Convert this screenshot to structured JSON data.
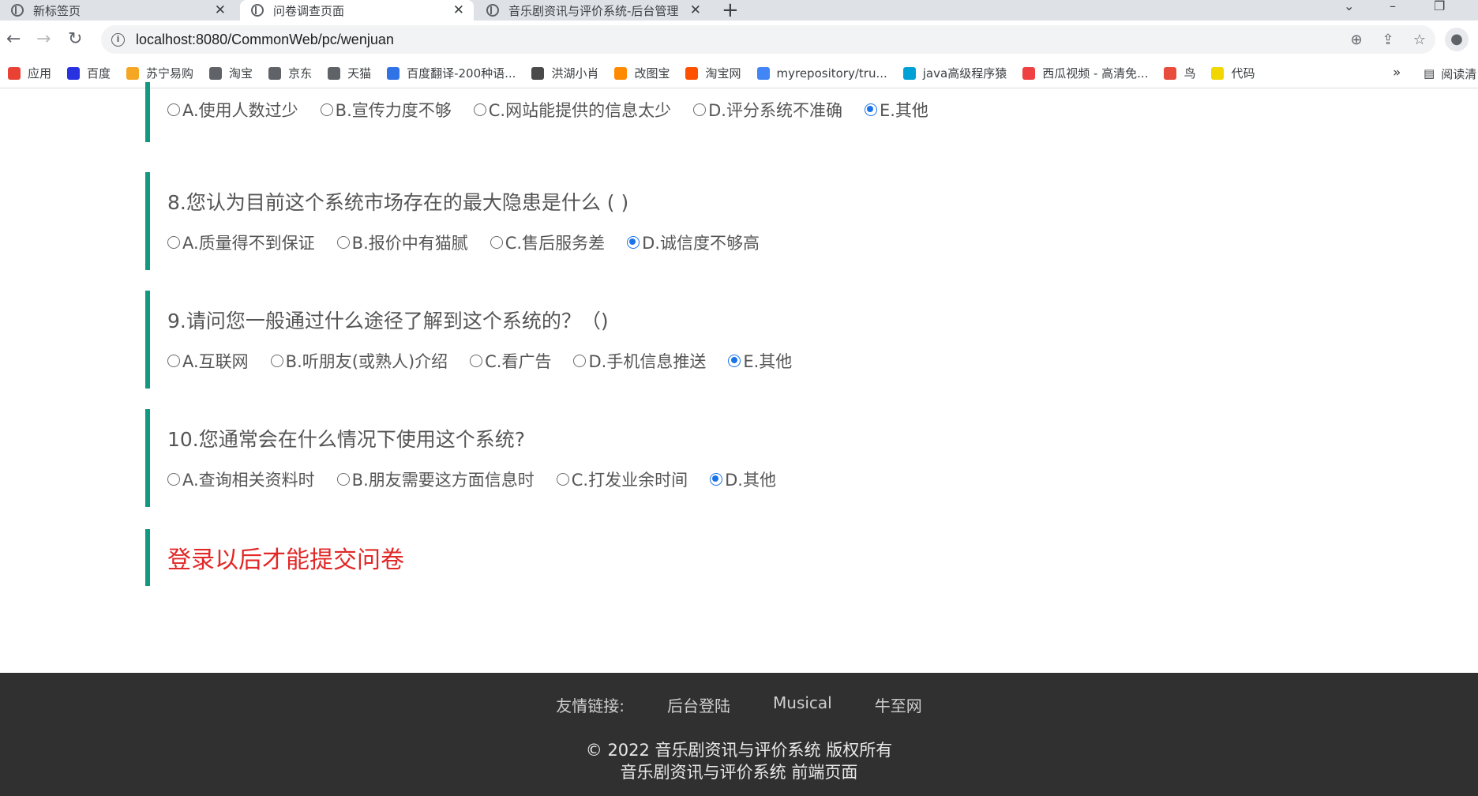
{
  "browser": {
    "tabs": [
      {
        "title": "新标签页",
        "close": "✕"
      },
      {
        "title": "问卷调查页面",
        "close": "✕"
      },
      {
        "title": "音乐剧资讯与评价系统-后台管理",
        "close": "✕"
      }
    ],
    "new_tab": "+",
    "url": "localhost:8080/CommonWeb/pc/wenjuan",
    "bookmarks": [
      {
        "label": "应用",
        "color": "#e94235"
      },
      {
        "label": "百度",
        "color": "#2932e1"
      },
      {
        "label": "苏宁易购",
        "color": "#f5a623"
      },
      {
        "label": "淘宝",
        "color": "#5f6368"
      },
      {
        "label": "京东",
        "color": "#5f6368"
      },
      {
        "label": "天猫",
        "color": "#5f6368"
      },
      {
        "label": "百度翻译-200种语...",
        "color": "#2f73e6"
      },
      {
        "label": "洪湖小肖",
        "color": "#4a4a4a"
      },
      {
        "label": "改图宝",
        "color": "#ff8a00"
      },
      {
        "label": "淘宝网",
        "color": "#ff5000"
      },
      {
        "label": "myrepository/tru...",
        "color": "#4285f4"
      },
      {
        "label": "java高级程序猿",
        "color": "#00a1d6"
      },
      {
        "label": "西瓜视频 - 高清免...",
        "color": "#f04142"
      },
      {
        "label": "鸟",
        "color": "#e74c3c"
      },
      {
        "label": "代码",
        "color": "#f2d600"
      }
    ],
    "bookmarks_more": "»",
    "reading_list": "阅读清"
  },
  "questions": [
    {
      "title": "",
      "options": [
        {
          "label": "A.使用人数过少",
          "checked": false
        },
        {
          "label": "B.宣传力度不够",
          "checked": false
        },
        {
          "label": "C.网站能提供的信息太少",
          "checked": false
        },
        {
          "label": "D.评分系统不准确",
          "checked": false
        },
        {
          "label": "E.其他",
          "checked": true
        }
      ]
    },
    {
      "title": "8.您认为目前这个系统市场存在的最大隐患是什么 ( )",
      "options": [
        {
          "label": "A.质量得不到保证",
          "checked": false
        },
        {
          "label": "B.报价中有猫腻",
          "checked": false
        },
        {
          "label": "C.售后服务差",
          "checked": false
        },
        {
          "label": "D.诚信度不够高",
          "checked": true
        }
      ]
    },
    {
      "title": "9.请问您一般通过什么途径了解到这个系统的？（)",
      "options": [
        {
          "label": "A.互联网",
          "checked": false
        },
        {
          "label": "B.听朋友(或熟人)介绍",
          "checked": false
        },
        {
          "label": "C.看广告",
          "checked": false
        },
        {
          "label": "D.手机信息推送",
          "checked": false
        },
        {
          "label": "E.其他",
          "checked": true
        }
      ]
    },
    {
      "title": "10.您通常会在什么情况下使用这个系统?",
      "options": [
        {
          "label": "A.查询相关资料时",
          "checked": false
        },
        {
          "label": "B.朋友需要这方面信息时",
          "checked": false
        },
        {
          "label": "C.打发业余时间",
          "checked": false
        },
        {
          "label": "D.其他",
          "checked": true
        }
      ]
    }
  ],
  "login_notice": "登录以后才能提交问卷",
  "footer": {
    "links_label": "友情链接:",
    "links": [
      "后台登陆",
      "Musical",
      "牛至网"
    ],
    "copyright": "© 2022 音乐剧资讯与评价系统 版权所有",
    "subtitle": "音乐剧资讯与评价系统 前端页面"
  }
}
